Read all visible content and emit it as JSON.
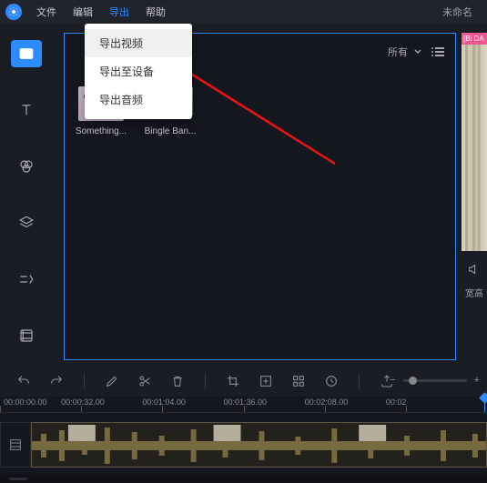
{
  "menubar": {
    "items": [
      "文件",
      "编辑",
      "导出",
      "帮助"
    ],
    "active_index": 2,
    "title": "未命名"
  },
  "export_menu": {
    "items": [
      "导出视频",
      "导出至设备",
      "导出音频"
    ],
    "hover_index": 0
  },
  "media_panel": {
    "filter_label": "所有",
    "clips": [
      {
        "label": "Something..."
      },
      {
        "label": "Bingle Ban..."
      }
    ]
  },
  "preview": {
    "badge_text": "[Bi\nDA",
    "fit_label": "宽高"
  },
  "side_tools": [
    "media",
    "text",
    "filters",
    "overlay",
    "transition",
    "element"
  ],
  "toolbar_icons": [
    "undo",
    "redo",
    "cut",
    "scissors",
    "delete",
    "crop",
    "add-marker",
    "stack",
    "clock",
    "export-icon"
  ],
  "timeline": {
    "ticks": [
      "00:00:00.00",
      "00:00:32.00",
      "00:01:04.00",
      "00:01:36.00",
      "00:02:08.00",
      "00:02"
    ]
  },
  "zoom": {
    "minus": "−",
    "plus": "+"
  }
}
